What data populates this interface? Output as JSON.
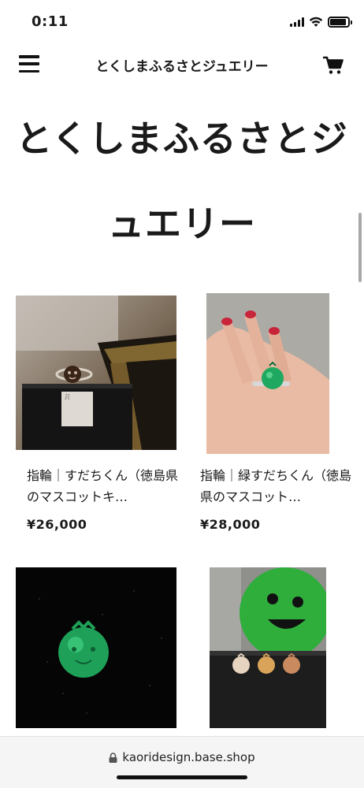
{
  "status_bar": {
    "time": "0:11"
  },
  "header": {
    "title": "とくしまふるさとジュエリー"
  },
  "shop": {
    "title": "とくしまふるさとジュエリー"
  },
  "products": [
    {
      "name": "指輪｜すだちくん（徳島県のマスコットキ…",
      "price": "¥26,000"
    },
    {
      "name": "指輪｜緑すだちくん（徳島県のマスコット…",
      "price": "¥28,000"
    },
    {
      "name": "",
      "price": ""
    },
    {
      "name": "",
      "price": ""
    }
  ],
  "browser": {
    "url": "kaoridesign.base.shop"
  },
  "colors": {
    "text": "#1a1a1a",
    "background": "#ffffff",
    "url_bar": "#f5f5f5"
  },
  "icons": [
    "menu-icon",
    "cart-icon",
    "lock-icon",
    "signal-icon",
    "wifi-icon",
    "battery-icon"
  ]
}
